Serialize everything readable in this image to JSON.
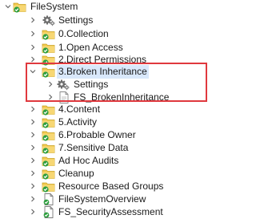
{
  "tree": {
    "root": {
      "label": "FileSystem"
    },
    "items": [
      {
        "label": "Settings"
      },
      {
        "label": "0.Collection"
      },
      {
        "label": "1.Open Access"
      },
      {
        "label": "2.Direct Permissions"
      },
      {
        "label": "3.Broken Inheritance"
      },
      {
        "label": "Settings"
      },
      {
        "label": "FS_BrokenInheritance"
      },
      {
        "label": "4.Content"
      },
      {
        "label": "5.Activity"
      },
      {
        "label": "6.Probable Owner"
      },
      {
        "label": "7.Sensitive Data"
      },
      {
        "label": "Ad Hoc Audits"
      },
      {
        "label": "Cleanup"
      },
      {
        "label": "Resource Based Groups"
      },
      {
        "label": "FileSystemOverview"
      },
      {
        "label": "FS_SecurityAssessment"
      }
    ]
  },
  "colors": {
    "folder": "#f2c94c",
    "check": "#2e9e3f",
    "highlight": "#e0393e",
    "selection": "#d9e8fb"
  }
}
